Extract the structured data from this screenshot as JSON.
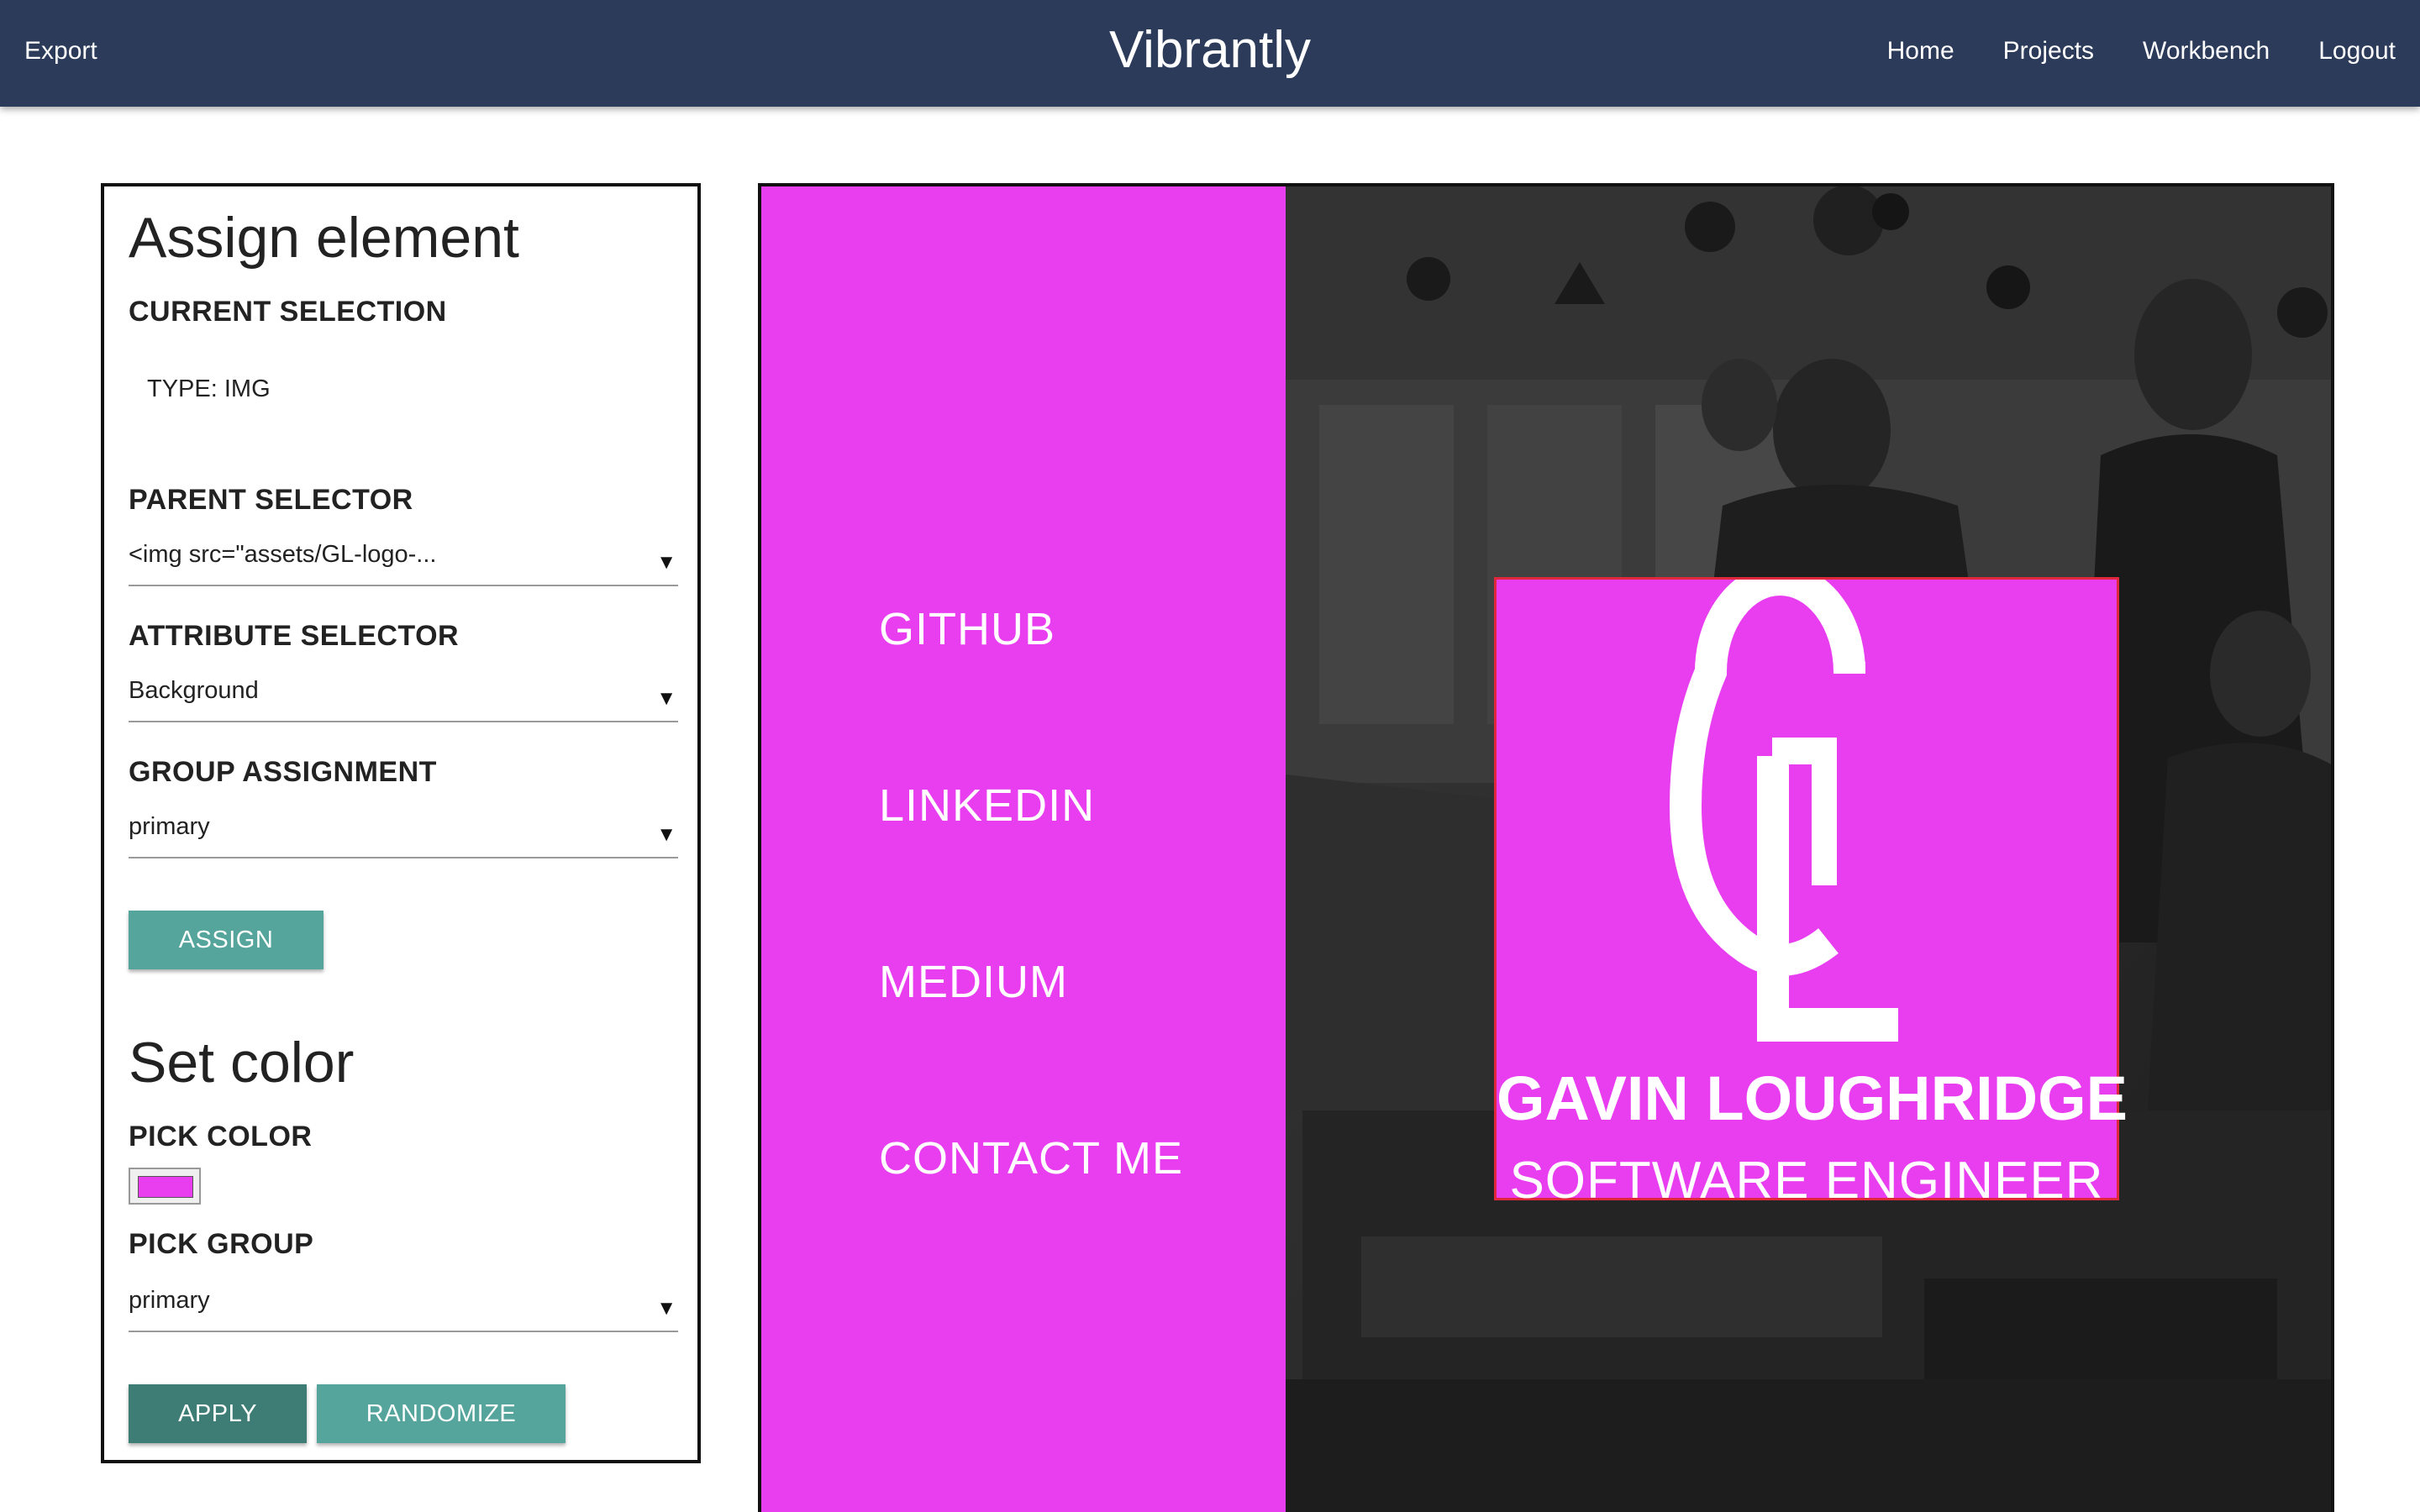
{
  "app": {
    "title": "Vibrantly",
    "export_label": "Export",
    "nav": [
      "Home",
      "Projects",
      "Workbench",
      "Logout"
    ]
  },
  "assign_panel": {
    "heading": "Assign element",
    "current_selection_label": "CURRENT SELECTION",
    "type_text": "TYPE: IMG",
    "parent_selector_label": "PARENT SELECTOR",
    "parent_selector_value": "<img src=\"assets/GL-logo-...",
    "attribute_selector_label": "ATTRIBUTE SELECTOR",
    "attribute_selector_value": "Background",
    "group_assignment_label": "GROUP ASSIGNMENT",
    "group_assignment_value": "primary",
    "assign_button": "ASSIGN"
  },
  "color_panel": {
    "heading": "Set color",
    "pick_color_label": "PICK COLOR",
    "picked_color": "#e83ef0",
    "pick_group_label": "PICK GROUP",
    "pick_group_value": "primary",
    "apply_button": "APPLY",
    "randomize_button": "RANDOMIZE"
  },
  "preview": {
    "sidebar_links": [
      "GITHUB",
      "LINKEDIN",
      "MEDIUM",
      "CONTACT ME"
    ],
    "logo_letters": "GL",
    "name": "GAVIN LOUGHRIDGE",
    "role": "SOFTWARE ENGINEER"
  },
  "colors": {
    "topbar": "#2c3b5a",
    "primary": "#e83ef0",
    "teal_button": "#55a59c",
    "teal_button_dark": "#3d7d75",
    "selection_outline": "#e0283c"
  }
}
